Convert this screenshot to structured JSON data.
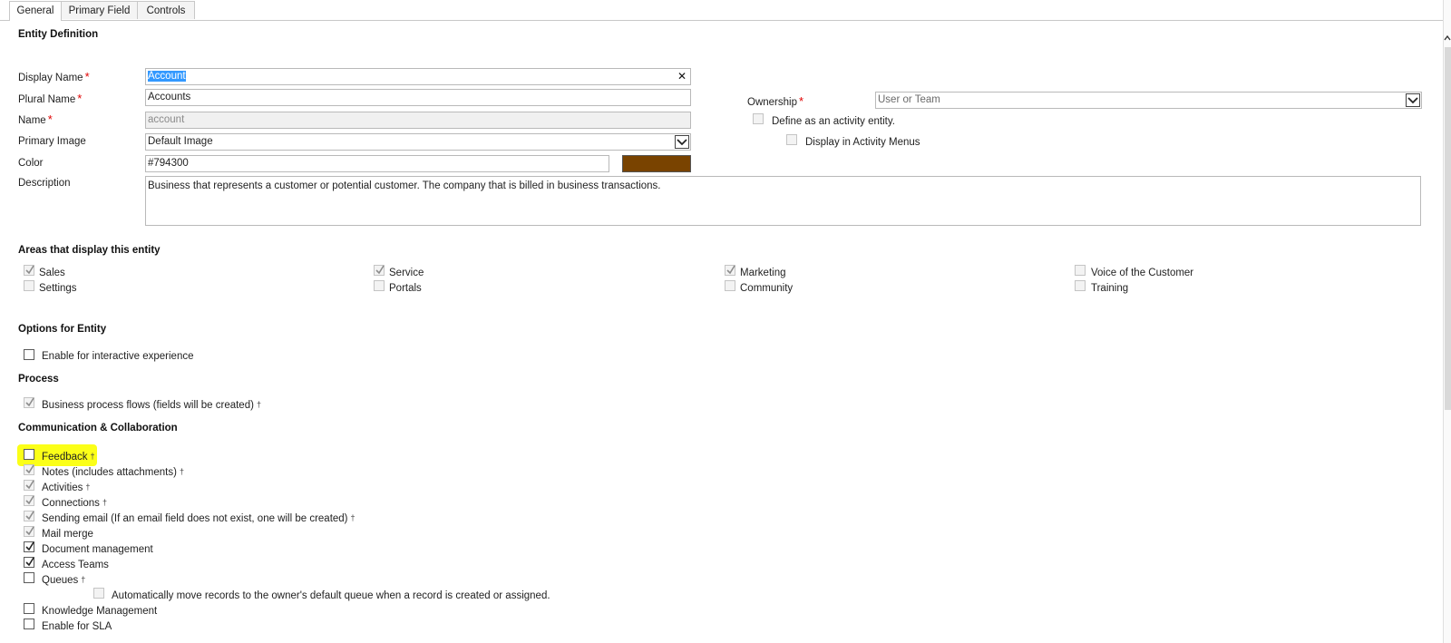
{
  "tabs": [
    "General",
    "Primary Field",
    "Controls"
  ],
  "entity_definition": {
    "heading": "Entity Definition",
    "display_name": {
      "label": "Display Name",
      "required_mark": "*",
      "value": "Account",
      "clear_glyph": "✕"
    },
    "plural_name": {
      "label": "Plural Name",
      "required_mark": "*",
      "value": "Accounts"
    },
    "name": {
      "label": "Name",
      "required_mark": "*",
      "value": "account"
    },
    "primary_image": {
      "label": "Primary Image",
      "value": "Default Image"
    },
    "color": {
      "label": "Color",
      "value": "#794300",
      "swatch": "#794300"
    },
    "description": {
      "label": "Description",
      "value": "Business that represents a customer or potential customer. The company that is billed in business transactions."
    },
    "ownership": {
      "label": "Ownership",
      "required_mark": "*",
      "value": "User or Team"
    },
    "define_activity": {
      "label": "Define as an activity entity.",
      "checked": false
    },
    "display_activity_menus": {
      "label": "Display in Activity Menus",
      "checked": false
    }
  },
  "areas": {
    "heading": "Areas that display this entity",
    "items": [
      {
        "label": "Sales",
        "checked": true
      },
      {
        "label": "Service",
        "checked": true
      },
      {
        "label": "Marketing",
        "checked": true
      },
      {
        "label": "Voice of the Customer",
        "checked": false
      },
      {
        "label": "Settings",
        "checked": false
      },
      {
        "label": "Portals",
        "checked": false
      },
      {
        "label": "Community",
        "checked": false
      },
      {
        "label": "Training",
        "checked": false
      }
    ]
  },
  "options": {
    "heading": "Options for Entity",
    "interactive": {
      "label": "Enable for interactive experience",
      "checked": false
    }
  },
  "process": {
    "heading": "Process",
    "bpf": {
      "label": "Business process flows (fields will be created)",
      "dagger": "†",
      "checked": true
    }
  },
  "communication": {
    "heading": "Communication & Collaboration",
    "items": [
      {
        "label": "Feedback",
        "dagger": "†",
        "checked": false,
        "disabled": false,
        "highlight": true
      },
      {
        "label": "Notes (includes attachments)",
        "dagger": "†",
        "checked": true,
        "disabled": true
      },
      {
        "label": "Activities",
        "dagger": "†",
        "checked": true,
        "disabled": true
      },
      {
        "label": "Connections",
        "dagger": "†",
        "checked": true,
        "disabled": true
      },
      {
        "label": "Sending email (If an email field does not exist, one will be created)",
        "dagger": "†",
        "checked": true,
        "disabled": true
      },
      {
        "label": "Mail merge",
        "dagger": "",
        "checked": true,
        "disabled": true
      },
      {
        "label": "Document management",
        "dagger": "",
        "checked": true,
        "disabled": false
      },
      {
        "label": "Access Teams",
        "dagger": "",
        "checked": true,
        "disabled": false
      },
      {
        "label": "Queues",
        "dagger": "†",
        "checked": false,
        "disabled": false
      },
      {
        "label": "Automatically move records to the owner's default queue when a record is created or assigned.",
        "dagger": "",
        "checked": false,
        "disabled": true
      },
      {
        "label": "Knowledge Management",
        "dagger": "",
        "checked": false,
        "disabled": false
      },
      {
        "label": "Enable for SLA",
        "dagger": "",
        "checked": false,
        "disabled": false
      }
    ]
  },
  "colors": {
    "highlight": "#fbff18",
    "required": "#e00000",
    "selection": "#3399ff"
  }
}
